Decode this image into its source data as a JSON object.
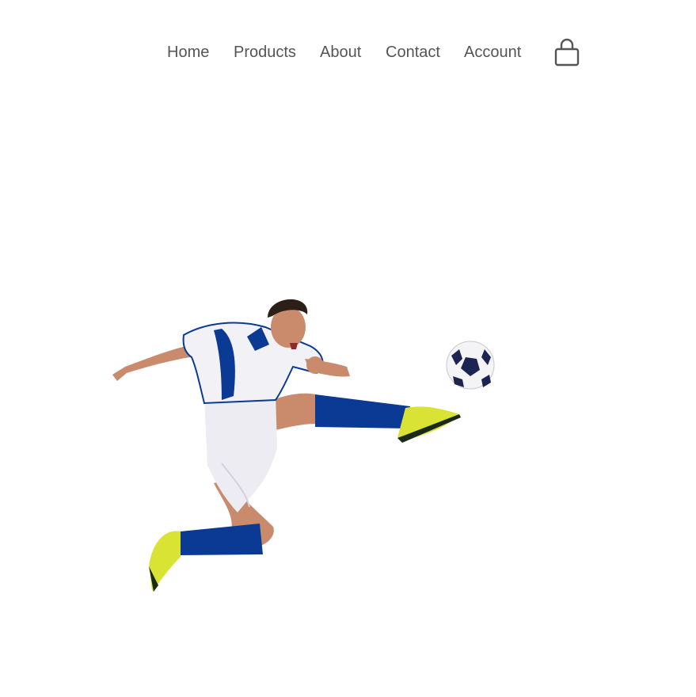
{
  "nav": {
    "items": [
      {
        "label": "Home"
      },
      {
        "label": "Products"
      },
      {
        "label": "About"
      },
      {
        "label": "Contact"
      },
      {
        "label": "Account"
      }
    ],
    "cart_icon": "shopping-bag-icon"
  },
  "hero": {
    "image": "soccer-player-kicking-ball",
    "colors": {
      "kit_blue": "#0a3a93",
      "kit_white": "#f2f2f6",
      "boots": "#d8e334",
      "skin": "#c98b6c",
      "hair": "#2b1f18"
    }
  }
}
